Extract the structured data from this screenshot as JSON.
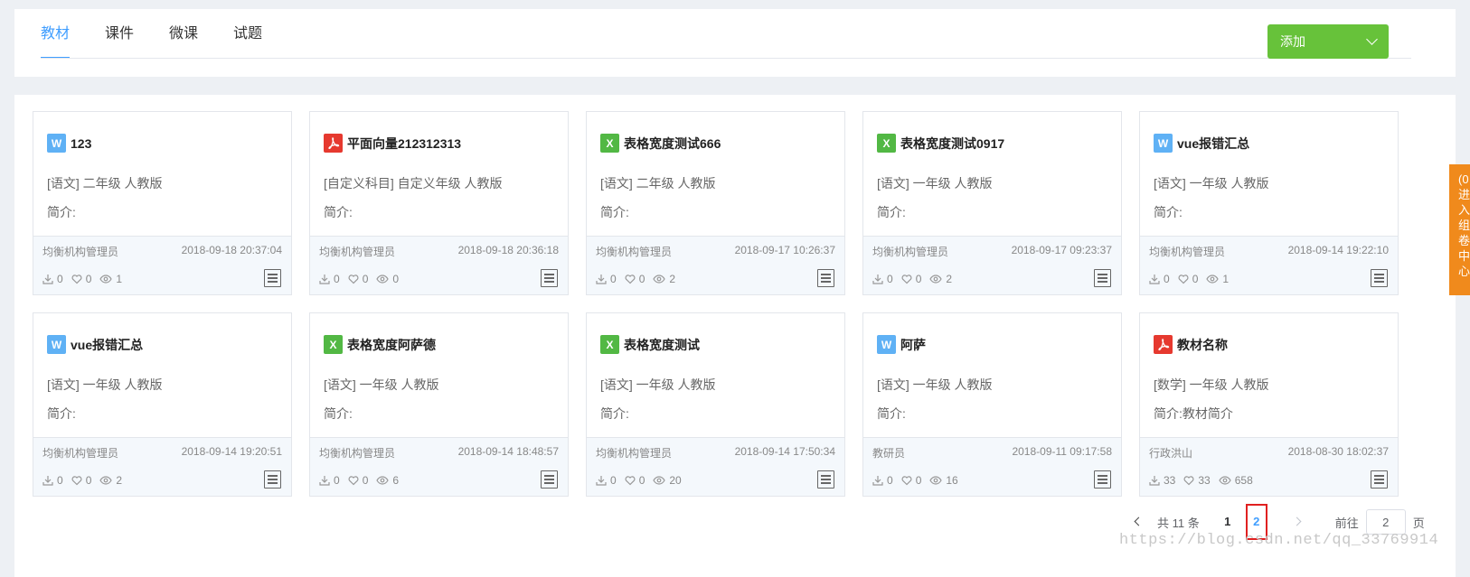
{
  "tabs": [
    "教材",
    "课件",
    "微课",
    "试题"
  ],
  "add_button": {
    "label": "添加",
    "icon": "chevron-down-icon"
  },
  "colors": {
    "accent": "#409eff",
    "add_button": "#67c23a",
    "side_tab": "#f08a1c",
    "word": "#5fb1f5",
    "excel": "#52b844",
    "pdf": "#e6392f"
  },
  "cards": [
    {
      "type": "w",
      "icon_text": "W",
      "title": "123",
      "meta": "[语文] 二年级 人教版",
      "desc": "简介:",
      "author": "均衡机构管理员",
      "time": "2018-09-18 20:37:04",
      "downloads": "0",
      "likes": "0",
      "views": "1"
    },
    {
      "type": "p",
      "icon_text": "",
      "title": "平面向量212312313",
      "meta": "[自定义科目] 自定义年级 人教版",
      "desc": "简介:",
      "author": "均衡机构管理员",
      "time": "2018-09-18 20:36:18",
      "downloads": "0",
      "likes": "0",
      "views": "0"
    },
    {
      "type": "x",
      "icon_text": "X",
      "title": "表格宽度测试666",
      "meta": "[语文] 二年级 人教版",
      "desc": "简介:",
      "author": "均衡机构管理员",
      "time": "2018-09-17 10:26:37",
      "downloads": "0",
      "likes": "0",
      "views": "2"
    },
    {
      "type": "x",
      "icon_text": "X",
      "title": "表格宽度测试0917",
      "meta": "[语文] 一年级 人教版",
      "desc": "简介:",
      "author": "均衡机构管理员",
      "time": "2018-09-17 09:23:37",
      "downloads": "0",
      "likes": "0",
      "views": "2"
    },
    {
      "type": "w",
      "icon_text": "W",
      "title": "vue报错汇总",
      "meta": "[语文] 一年级 人教版",
      "desc": "简介:",
      "author": "均衡机构管理员",
      "time": "2018-09-14 19:22:10",
      "downloads": "0",
      "likes": "0",
      "views": "1"
    },
    {
      "type": "w",
      "icon_text": "W",
      "title": "vue报错汇总",
      "meta": "[语文] 一年级 人教版",
      "desc": "简介:",
      "author": "均衡机构管理员",
      "time": "2018-09-14 19:20:51",
      "downloads": "0",
      "likes": "0",
      "views": "2"
    },
    {
      "type": "x",
      "icon_text": "X",
      "title": "表格宽度阿萨德",
      "meta": "[语文] 一年级 人教版",
      "desc": "简介:",
      "author": "均衡机构管理员",
      "time": "2018-09-14 18:48:57",
      "downloads": "0",
      "likes": "0",
      "views": "6"
    },
    {
      "type": "x",
      "icon_text": "X",
      "title": "表格宽度测试",
      "meta": "[语文] 一年级 人教版",
      "desc": "简介:",
      "author": "均衡机构管理员",
      "time": "2018-09-14 17:50:34",
      "downloads": "0",
      "likes": "0",
      "views": "20"
    },
    {
      "type": "w",
      "icon_text": "W",
      "title": "阿萨",
      "meta": "[语文] 一年级 人教版",
      "desc": "简介:",
      "author": "教研员",
      "time": "2018-09-11 09:17:58",
      "downloads": "0",
      "likes": "0",
      "views": "16"
    },
    {
      "type": "p",
      "icon_text": "",
      "title": "教材名称",
      "meta": "[数学] 一年级 人教版",
      "desc": "简介:教材简介",
      "author": "行政洪山",
      "time": "2018-08-30 18:02:37",
      "downloads": "33",
      "likes": "33",
      "views": "658"
    }
  ],
  "pagination": {
    "total": "共 11 条",
    "pages": [
      "1",
      "2"
    ],
    "current": "2",
    "goto_label": "前往",
    "goto_value": "2",
    "page_unit": "页"
  },
  "side_tab": [
    "(0",
    "进",
    "入",
    "组",
    "卷",
    "中",
    "心"
  ],
  "watermark": "https://blog.csdn.net/qq_33769914"
}
